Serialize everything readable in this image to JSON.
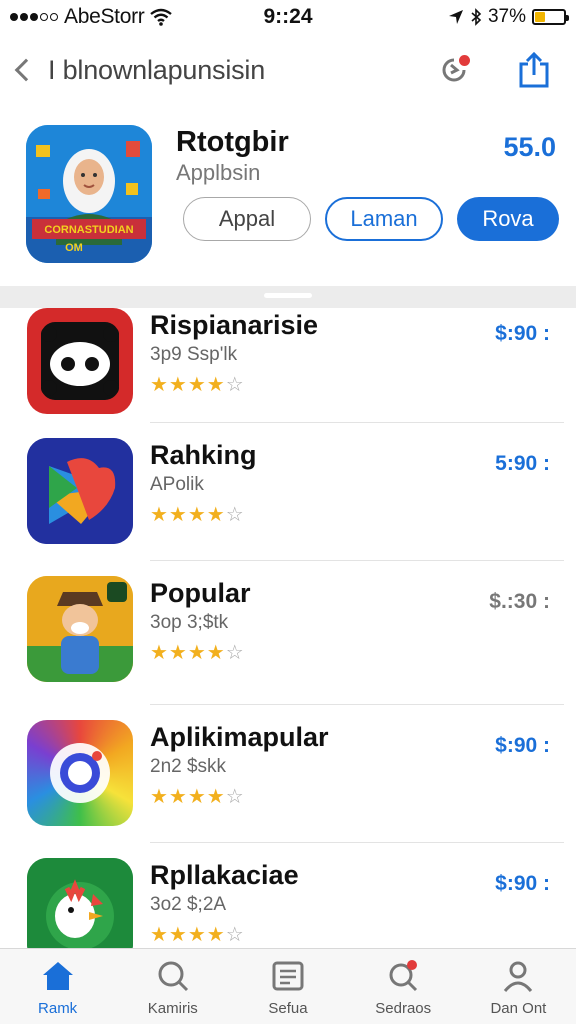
{
  "status_bar": {
    "carrier": "AbeStorr",
    "time": "9::24",
    "battery": "37%",
    "battery_level": 0.37
  },
  "nav": {
    "title": "I blnownlapunsisin"
  },
  "hero": {
    "name": "Rtotgbir",
    "subtitle": "Applbsin",
    "price": "55.0",
    "buttons": [
      "Appal",
      "Laman",
      "Rova"
    ],
    "icon_texts": [
      "CORNASTUDIAN",
      "OM"
    ]
  },
  "list": {
    "items": [
      {
        "name": "Rispianarisie",
        "subtitle": "3p9 Ssp'lk",
        "rating": 4,
        "max_rating": 5,
        "price": "$:90 :",
        "icon": "panda-face-icon",
        "price_color": "#1a6fd8"
      },
      {
        "name": "Rahking",
        "subtitle": "APolik",
        "rating": 4,
        "max_rating": 5,
        "price": "5:90 :",
        "icon": "play-heart-icon",
        "price_color": "#1a6fd8"
      },
      {
        "name": "Popular",
        "subtitle": "3op 3;$tk",
        "rating": 4,
        "max_rating": 5,
        "price": "$.:30 :",
        "icon": "cartoon-character-icon",
        "price_color": "#777777"
      },
      {
        "name": "Aplikimapular",
        "subtitle": "2n2 $skk",
        "rating": 4,
        "max_rating": 5,
        "price": "$:90 :",
        "icon": "camera-lens-icon",
        "price_color": "#1a6fd8"
      },
      {
        "name": "Rpllakaciae",
        "subtitle": "3o2 $;2A",
        "rating": 4,
        "max_rating": 5,
        "price": "$:90 :",
        "icon": "chicken-icon",
        "price_color": "#1a6fd8"
      }
    ]
  },
  "tabbar": {
    "tabs": [
      {
        "label": "Ramk",
        "icon": "home-icon",
        "active": true
      },
      {
        "label": "Kamiris",
        "icon": "search-chat-icon",
        "active": false
      },
      {
        "label": "Sefua",
        "icon": "news-icon",
        "active": false
      },
      {
        "label": "Sedraos",
        "icon": "search-icon",
        "active": false
      },
      {
        "label": "Dan Ont",
        "icon": "person-icon",
        "active": false
      }
    ]
  },
  "colors": {
    "accent": "#1a6fd8",
    "star": "#f2b01e",
    "badge": "#e23b3b"
  }
}
